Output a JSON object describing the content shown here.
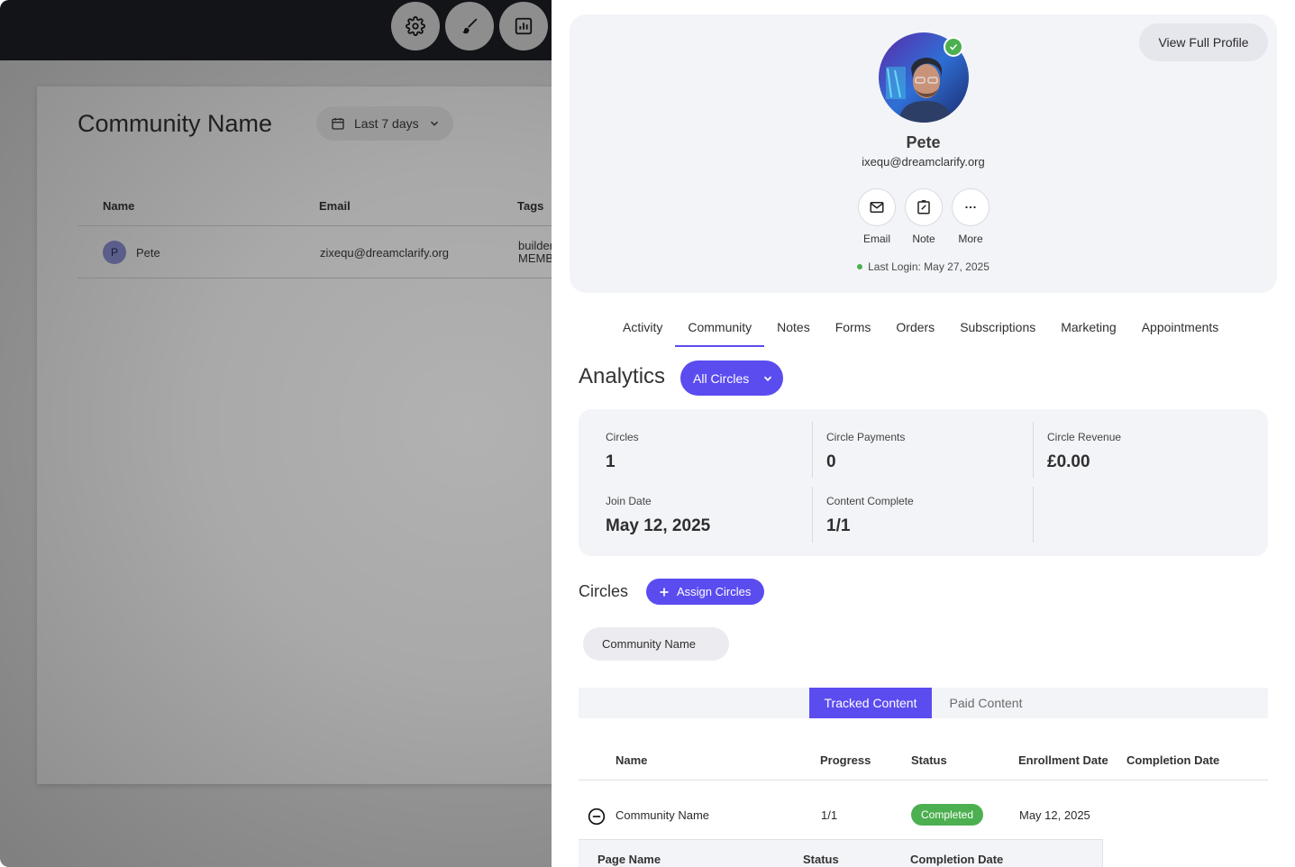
{
  "background": {
    "toolbar_icons": [
      "gear-icon",
      "paintbrush-icon",
      "report-icon"
    ],
    "page_title": "Community Name",
    "date_filter": "Last 7 days",
    "table": {
      "headers": [
        "Name",
        "Email",
        "Tags"
      ],
      "row": {
        "avatar_initial": "P",
        "name": "Pete",
        "email": "zixequ@dreamclarify.org",
        "tags_line1": "builder",
        "tags_line2": "MEMB"
      }
    }
  },
  "profile": {
    "view_full_profile": "View Full Profile",
    "name": "Pete",
    "email": "ixequ@dreamclarify.org",
    "actions": [
      {
        "label": "Email",
        "icon": "mail-icon"
      },
      {
        "label": "Note",
        "icon": "note-icon"
      },
      {
        "label": "More",
        "icon": "more-icon"
      }
    ],
    "last_login": "Last Login: May 27, 2025"
  },
  "tabs": [
    "Activity",
    "Community",
    "Notes",
    "Forms",
    "Orders",
    "Subscriptions",
    "Marketing",
    "Appointments"
  ],
  "active_tab": "Community",
  "analytics": {
    "title": "Analytics",
    "filter": "All Circles",
    "stats": {
      "circles": {
        "label": "Circles",
        "value": "1"
      },
      "circle_payments": {
        "label": "Circle Payments",
        "value": "0"
      },
      "circle_revenue": {
        "label": "Circle Revenue",
        "value": "£0.00"
      },
      "join_date": {
        "label": "Join Date",
        "value": "May 12, 2025"
      },
      "content_complete": {
        "label": "Content Complete",
        "value": "1/1"
      }
    }
  },
  "circles": {
    "title": "Circles",
    "assign_button": "Assign Circles",
    "chips": [
      "Community Name"
    ]
  },
  "content": {
    "tabs": {
      "tracked": "Tracked Content",
      "paid": "Paid Content"
    },
    "headers": {
      "name": "Name",
      "progress": "Progress",
      "status": "Status",
      "enrollment": "Enrollment Date",
      "completion": "Completion Date"
    },
    "row": {
      "name": "Community Name",
      "progress": "1/1",
      "status": "Completed",
      "enrollment": "May 12, 2025",
      "completion": ""
    },
    "subtable_headers": {
      "page_name": "Page Name",
      "status": "Status",
      "completion": "Completion Date"
    }
  },
  "colors": {
    "accent": "#5b4cf0",
    "success": "#4caf50",
    "card_bg": "#f3f4f8"
  }
}
